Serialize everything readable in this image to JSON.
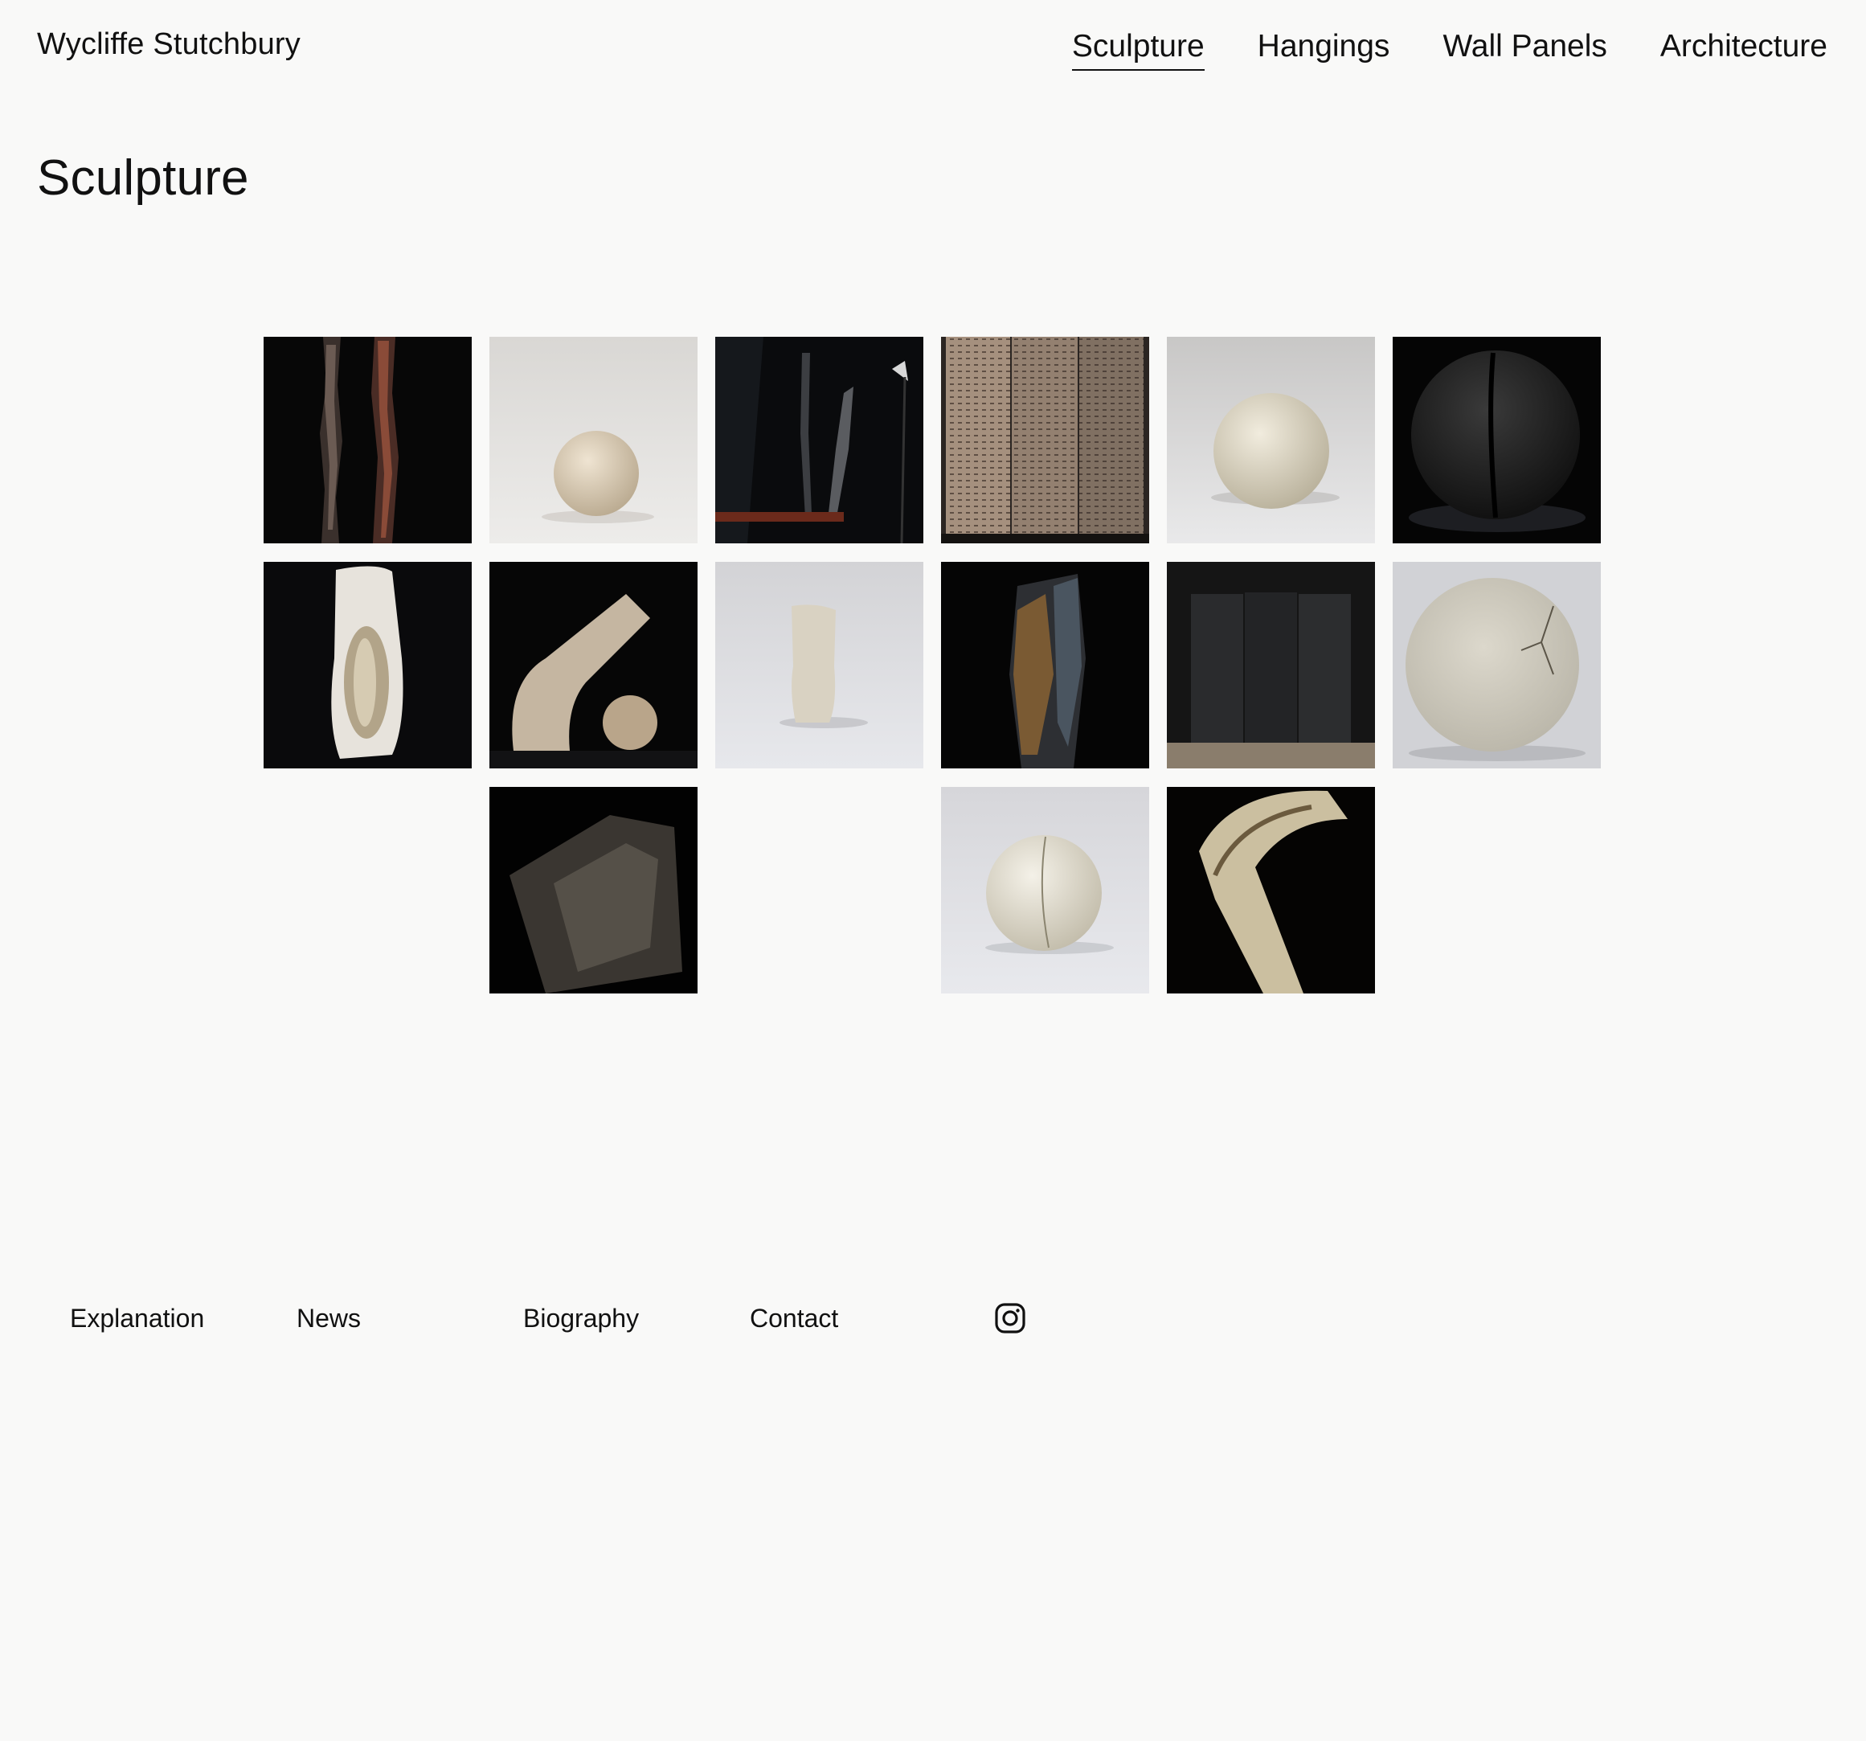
{
  "site": {
    "name": "Wycliffe Stutchbury"
  },
  "nav": {
    "items": [
      {
        "label": "Sculpture",
        "active": true
      },
      {
        "label": "Hangings",
        "active": false
      },
      {
        "label": "Wall Panels",
        "active": false
      },
      {
        "label": "Architecture",
        "active": false
      }
    ]
  },
  "page": {
    "title": "Sculpture"
  },
  "gallery": {
    "tiles": [
      {
        "subject": "tall-dark-vertical-forms"
      },
      {
        "subject": "small-pale-sphere"
      },
      {
        "subject": "dark-twisted-standing-form"
      },
      {
        "subject": "textured-folding-screen"
      },
      {
        "subject": "pale-sphere"
      },
      {
        "subject": "black-split-sphere"
      },
      {
        "subject": "white-trunk-with-seed"
      },
      {
        "subject": "bent-branch-and-ball"
      },
      {
        "subject": "pale-trunk-form"
      },
      {
        "subject": "dark-weathered-column"
      },
      {
        "subject": "dark-panel-screen"
      },
      {
        "subject": "cracked-pale-disc"
      },
      {
        "subject": "dark-wood-fragment"
      },
      {
        "subject": "cracked-white-sphere"
      },
      {
        "subject": "curved-bone-form"
      }
    ]
  },
  "footer": {
    "links": [
      "Explanation",
      "News",
      "Biography",
      "Contact"
    ],
    "social_icon": "instagram-icon"
  },
  "colors": {
    "background": "#f9f9f8",
    "text": "#111111"
  }
}
